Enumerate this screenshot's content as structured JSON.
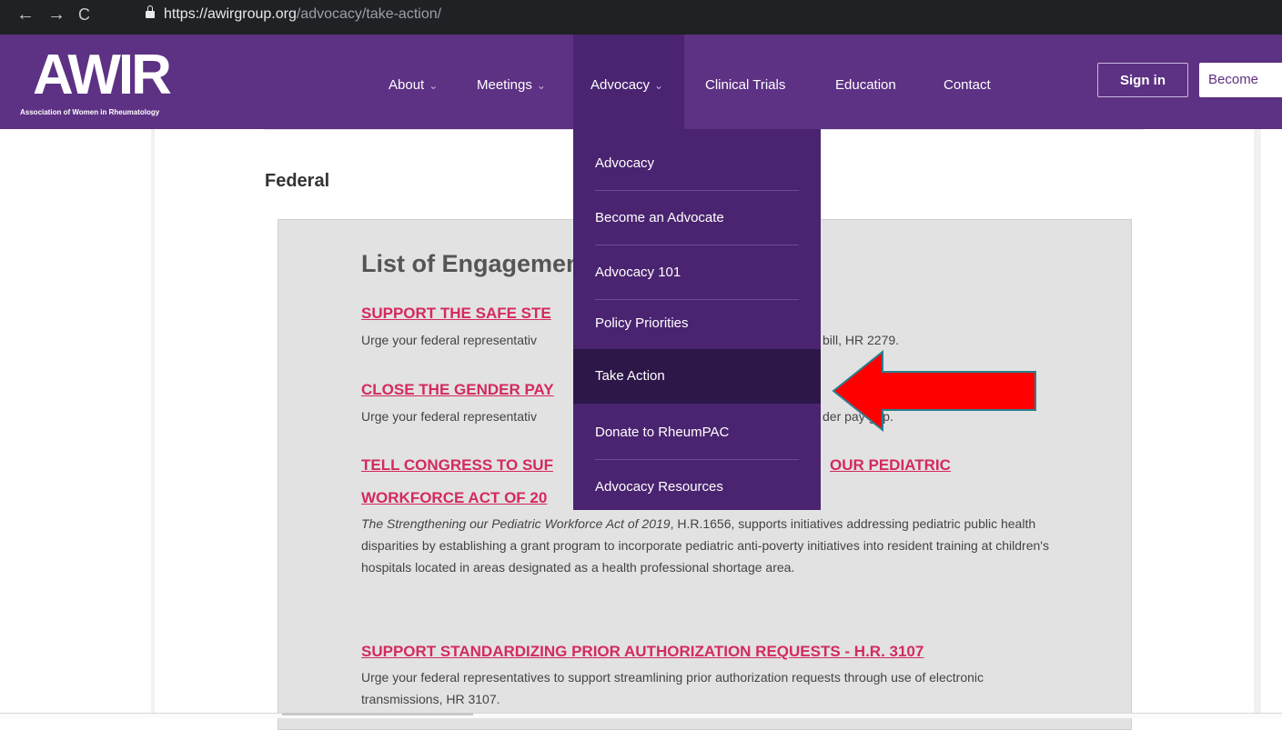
{
  "browser": {
    "back": "←",
    "forward": "→",
    "reload": "C",
    "url_domain": "https://awirgroup.org",
    "url_path": "/advocacy/take-action/"
  },
  "header": {
    "logo_text": "AWIR",
    "logo_subtitle": "Association of Women in Rheumatology",
    "menu": [
      {
        "label": "About",
        "has_chevron": true
      },
      {
        "label": "Meetings",
        "has_chevron": true
      },
      {
        "label": "Advocacy",
        "has_chevron": true
      },
      {
        "label": "Clinical Trials",
        "has_chevron": false
      },
      {
        "label": "Education",
        "has_chevron": false
      },
      {
        "label": "Contact",
        "has_chevron": false
      }
    ],
    "sign_in": "Sign in",
    "become": "Become"
  },
  "dropdown": {
    "items": [
      "Advocacy",
      "Become an Advocate",
      "Advocacy 101",
      "Policy Priorities",
      "Take Action",
      "Donate to RheumPAC",
      "Advocacy Resources"
    ],
    "active": "Take Action"
  },
  "page": {
    "section": "Federal",
    "panel_title": "List of Engagemen",
    "items": [
      {
        "title": "SUPPORT THE SAFE STE",
        "desc": "Urge your federal representativ",
        "desc_tail": "bill, HR 2279."
      },
      {
        "title": "CLOSE THE GENDER PAY",
        "desc": "Urge your federal representativ",
        "desc_tail": "der pay gap."
      },
      {
        "title_line1": "TELL CONGRESS TO SUF",
        "title_line1_tail": "OUR PEDIATRIC",
        "title_line2": "WORKFORCE ACT OF 20",
        "desc_italic": "The Strengthening our Pediatric Workforce Act of 2019",
        "desc_rest": ", H.R.1656, supports initiatives addressing pediatric public health disparities by establishing a grant program to incorporate pediatric anti-poverty initiatives into resident training at children's hospitals located in areas designated as a health professional shortage area."
      },
      {
        "title": "SUPPORT STANDARDIZING PRIOR AUTHORIZATION REQUESTS - H.R. 3107",
        "desc": "Urge your federal representatives to support streamlining prior authorization requests through use of electronic transmissions, HR 3107."
      }
    ]
  },
  "colors": {
    "brand_purple": "#5d3183",
    "dropdown_purple": "#4a2470",
    "active_item": "#2d1748",
    "link_pink": "#d42a5d",
    "arrow_red": "#ff0000"
  }
}
